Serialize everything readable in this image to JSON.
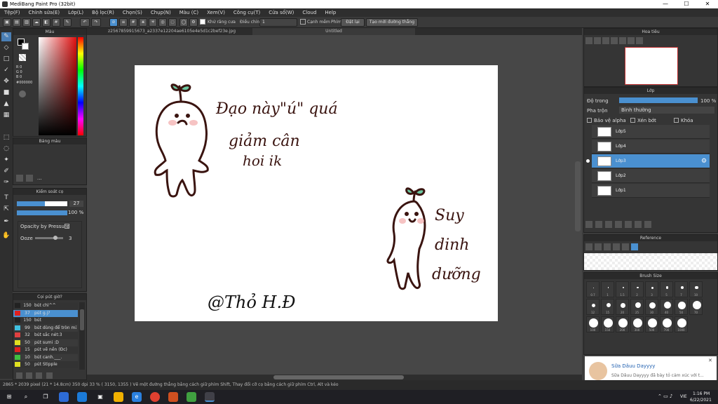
{
  "window": {
    "title": "MediBang Paint Pro (32bit)",
    "minimize": "—",
    "maximize": "☐",
    "close": "✕"
  },
  "menu": [
    "Tệp(F)",
    "Chỉnh sửa(E)",
    "Lớp(L)",
    "Bộ lọc(R)",
    "Chọn(S)",
    "Chụp(N)",
    "Màu (C)",
    "Xem(V)",
    "Công cụ(T)",
    "Cửa sổ(W)",
    "Cloud",
    "Help"
  ],
  "toolbar": {
    "anti_alias": "Khử răng cưa",
    "correction_label": "Điều chỉnh",
    "correction_value": "1",
    "edge": "Cạnh mềm",
    "snap_label": "Phím",
    "snap_off": "Đặt lại",
    "ruler": "Tạo mới đường thẳng"
  },
  "tabs": [
    "z2567859915673_a2337e12204ae6105e4e5d1c2bef23e.jpg",
    "Untitled"
  ],
  "color_panel": {
    "title": "Màu",
    "r": "R 0",
    "g": "G 0",
    "b": "B 0",
    "hex": "#000000"
  },
  "swatch_panel": {
    "title": "Bảng màu",
    "more": "..."
  },
  "brush_ctrl": {
    "title": "Kiểm soát cọ",
    "size": "27",
    "opacity": "100 %",
    "pressure": "Opacity by Pressure",
    "ooze_label": "Ooze",
    "ooze_value": "3"
  },
  "brush_list": {
    "title": "Cọi pút giờ?",
    "items": [
      {
        "size": "150",
        "name": "bút chì^^",
        "color": "#222222"
      },
      {
        "size": "37",
        "name": "pút g.j?",
        "color": "#e02020"
      },
      {
        "size": "150",
        "name": "bút",
        "color": "#222222"
      },
      {
        "size": "99",
        "name": "bút dùng để tròn mà",
        "color": "#40c0e0"
      },
      {
        "size": "32",
        "name": "bút sắc nét:3",
        "color": "#e04040"
      },
      {
        "size": "50",
        "name": "pút sumi :D",
        "color": "#e0e020"
      },
      {
        "size": "15",
        "name": "pút vẽ nền (Đc)",
        "color": "#e02020"
      },
      {
        "size": "10",
        "name": "bút canh.___.",
        "color": "#40c040"
      },
      {
        "size": "50",
        "name": "pút Stipple",
        "color": "#e0e020"
      }
    ]
  },
  "navigator": {
    "title": "Hoa tiêu"
  },
  "layers": {
    "title": "Lớp",
    "opacity_label": "Độ trong",
    "opacity_value": "100 %",
    "opacity_fraction": 1.0,
    "blend_label": "Pha trộn",
    "blend_value": "Bình thường",
    "protect_alpha": "Bảo vệ alpha",
    "clip": "Xén bớt",
    "lock": "Khóa",
    "items": [
      "Lớp5",
      "Lớp4",
      "Lớp3",
      "Lớp2",
      "Lớp1"
    ]
  },
  "reference": {
    "title": "Reference"
  },
  "brush_size": {
    "title": "Brush Size",
    "sizes": [
      "0.7",
      "1",
      "1.5",
      "2",
      "3",
      "5",
      "7",
      "10",
      "12",
      "15",
      "20",
      "25",
      "30",
      "40",
      "50",
      "70",
      "100",
      "150",
      "200",
      "300",
      "500",
      "700",
      "1000"
    ]
  },
  "status": {
    "text": "2865 * 2039 pixel  (21 * 14.8cm)  350 dpi  33 %  ( 3150, 1355 )  Vẽ một đường thẳng bằng cách giữ phím Shift, Thay đổi cỡ cọ bằng cách giữ phím Ctrl, Alt và kéo"
  },
  "notification": {
    "name": "Sữa Dâuu Dayyyy",
    "title": "Sữa Dâuu Dayyyy",
    "body": "Sữa Dâuu Dayyyy đã bày tỏ cảm xúc với t...",
    "close": "✕"
  },
  "taskbar": {
    "time": "1:16 PM",
    "date": "6/22/2021",
    "lang": "VIE"
  },
  "artwork": {
    "text1": "Đạo này\"ú\" quá",
    "text2": "giảm cân",
    "text3": "hoi ik",
    "text4": "Suy",
    "text5": "dinh",
    "text6": "dưỡng",
    "signature": "@Thỏ H.Đ"
  },
  "colors": {
    "accent": "#4a90d0",
    "red": "#e02020"
  }
}
